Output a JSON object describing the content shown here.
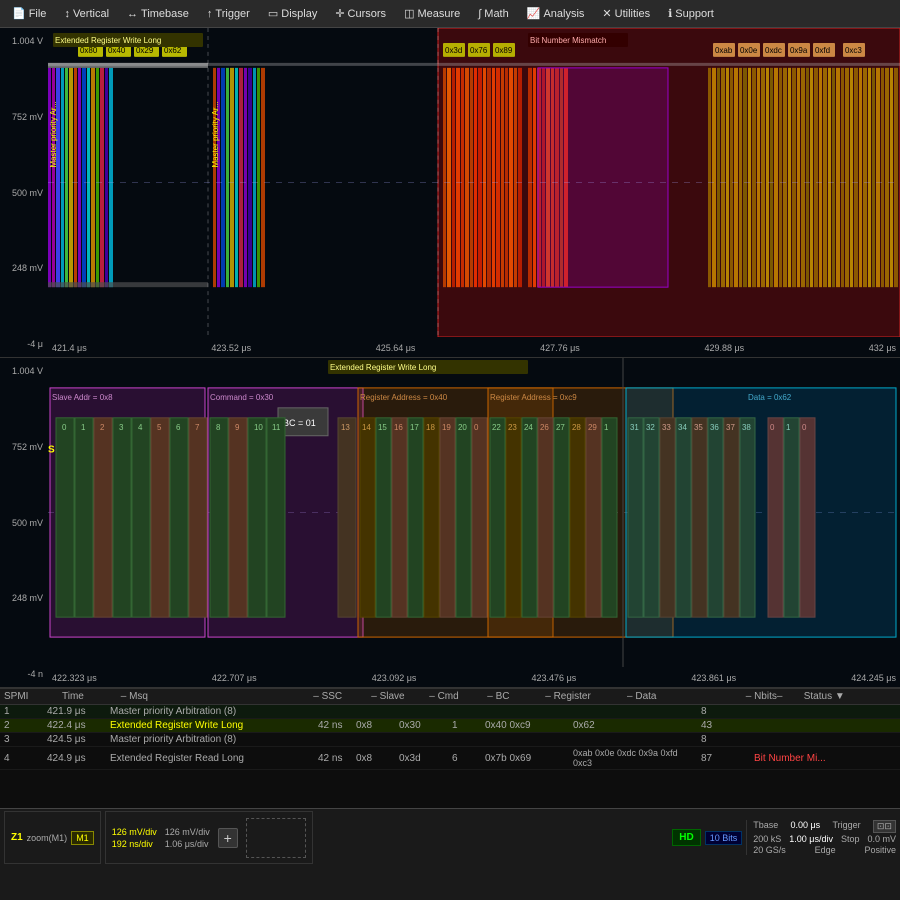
{
  "menu": {
    "items": [
      {
        "label": "File",
        "icon": "📄"
      },
      {
        "label": "Vertical",
        "icon": "↕"
      },
      {
        "label": "Timebase",
        "icon": "↔"
      },
      {
        "label": "Trigger",
        "icon": "↑"
      },
      {
        "label": "Display",
        "icon": "▭"
      },
      {
        "label": "Cursors",
        "icon": "✛"
      },
      {
        "label": "Measure",
        "icon": "◫"
      },
      {
        "label": "Math",
        "icon": "∫"
      },
      {
        "label": "Analysis",
        "icon": "📈"
      },
      {
        "label": "Utilities",
        "icon": "✕"
      },
      {
        "label": "Support",
        "icon": "ℹ"
      }
    ]
  },
  "top_panel": {
    "y_labels": [
      "1.004 V",
      "752 mV",
      "500 mV",
      "248 mV",
      "-4 μ"
    ],
    "x_labels": [
      "421.4 μs",
      "423.52 μs",
      "425.64 μs",
      "427.76 μs",
      "429.88 μs",
      "432 μs"
    ],
    "annotations": {
      "top_left": "Extended Register Write Long",
      "top_right": "Bit Number Mismatch",
      "hex_left": [
        "0x80",
        "0x40",
        "0x29",
        "0x62"
      ],
      "hex_mid": [
        "0x3d",
        "0x76",
        "0x89"
      ],
      "hex_right": [
        "0xab",
        "0x0e",
        "0xdc",
        "0x9a",
        "0xfd",
        "0xc3"
      ],
      "master_priority": "Master priority Ar..."
    }
  },
  "bottom_panel": {
    "y_labels": [
      "1.004 V",
      "752 mV",
      "500 mV",
      "248 mV",
      "-4 n"
    ],
    "x_labels": [
      "422.323 μs",
      "422.707 μs",
      "423.092 μs",
      "423.476 μs",
      "423.861 μs",
      "424.245 μs"
    ],
    "title": "Extended Register Write Long",
    "sections": [
      {
        "label": "Slave Addr = 0x8",
        "color": "#cc44cc"
      },
      {
        "label": "Command = 0x30",
        "color": "#cc44cc"
      },
      {
        "label": "Register Address = 0x40",
        "color": "#cc6600"
      },
      {
        "label": "Register Address = 0xc9",
        "color": "#cc6600"
      },
      {
        "label": "Data = 0x62",
        "color": "#00aacc"
      }
    ],
    "bc_label": "BC = 01",
    "s_label": "S",
    "bit_numbers_left": [
      "0",
      "1",
      "2",
      "3",
      "4",
      "5",
      "6",
      "7",
      "8",
      "9",
      "10",
      "11"
    ],
    "bit_numbers_mid": [
      "13",
      "14",
      "15",
      "16",
      "17",
      "18",
      "19",
      "20",
      "0"
    ],
    "bit_numbers_right1": [
      "22",
      "23",
      "24",
      "26",
      "27",
      "28",
      "29",
      "1"
    ],
    "bit_numbers_right2": [
      "31",
      "32",
      "33",
      "34",
      "35",
      "36",
      "37",
      "38",
      "0",
      "1",
      "0"
    ]
  },
  "table": {
    "headers": [
      "SPMI",
      "Time",
      "– Msq",
      "– SSC",
      "– Slave",
      "– Cmd – BC",
      "– Register",
      "– Data",
      "– Nbits–",
      "Status"
    ],
    "rows": [
      {
        "spmi": "1",
        "time": "421.9 μs",
        "msq": "Master priority Arbitration (8)",
        "ssc": "",
        "slave": "",
        "cmd": "",
        "bc": "",
        "register": "",
        "data": "",
        "nbits": "8",
        "status": "",
        "highlight": false
      },
      {
        "spmi": "2",
        "time": "422.4 μs",
        "msq": "Extended Register Write Long",
        "ssc": "42 ns",
        "slave": "0x8",
        "cmd": "0x30",
        "bc": "1",
        "register": "0x40 0xc9",
        "data": "0x62",
        "nbits": "43",
        "status": "",
        "highlight": true
      },
      {
        "spmi": "3",
        "time": "424.5 μs",
        "msq": "Master priority Arbitration (8)",
        "ssc": "",
        "slave": "",
        "cmd": "",
        "bc": "",
        "register": "",
        "data": "",
        "nbits": "8",
        "status": "",
        "highlight": false
      },
      {
        "spmi": "4",
        "time": "424.9 μs",
        "msq": "Extended Register Read Long",
        "ssc": "42 ns",
        "slave": "0x8",
        "cmd": "0x3d",
        "bc": "6",
        "register": "0x7b 0x69",
        "data": "0xab 0x0e 0xdc 0x9a 0xfd 0xc3",
        "nbits": "87",
        "status": "Bit Number Mi...",
        "highlight": false
      }
    ]
  },
  "status_bar": {
    "z1_label": "Z1",
    "zoom_label": "zoom(M1)",
    "m1_label": "M1",
    "ch1_scale": "126 mV/div",
    "ch1_offset": "126 mV/div",
    "time_scale": "192 ns/div",
    "time_offset": "1.06 μs/div",
    "hd_label": "HD",
    "bits_label": "10 Bits",
    "samples_label": "200 kS",
    "tbase": "0.00 μs",
    "tbase_per_div": "1.00 μs/div",
    "sample_rate": "20 GS/s",
    "trigger_label": "Trigger",
    "trigger_mode": "Stop",
    "trigger_type": "Edge",
    "trigger_level": "0.0 mV",
    "trigger_coupling": "Positive"
  }
}
